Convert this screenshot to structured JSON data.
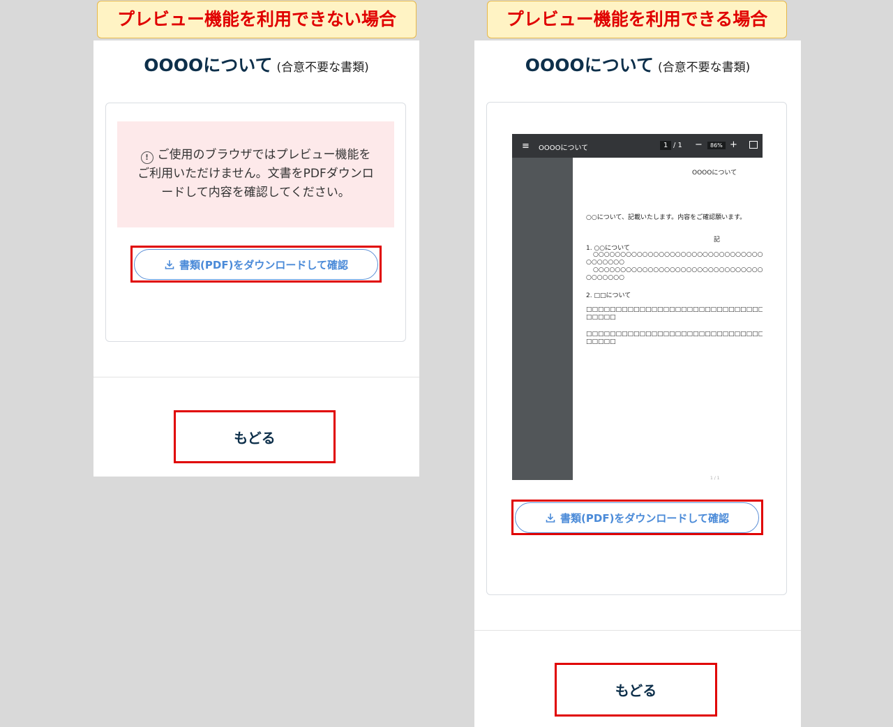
{
  "left": {
    "label": "プレビュー機能を利用できない場合",
    "title": "OOOOについて",
    "subtitle": "(合意不要な書類)",
    "alert_icon": "exclamation-circle-icon",
    "alert_text_1": "ご使用のブラウザではプレビュー機能を",
    "alert_text_2": "ご利用いただけません。文書をPDFダウンロ",
    "alert_text_3": "ードして内容を確認してください。",
    "download_label": "書類(PDF)をダウンロードして確認",
    "back_label": "もどる"
  },
  "right": {
    "label": "プレビュー機能を利用できる場合",
    "title": "OOOOについて",
    "subtitle": "(合意不要な書類)",
    "download_label": "書類(PDF)をダウンロードして確認",
    "back_label": "もどる",
    "viewer": {
      "doc_name": "OOOOについて",
      "page_current": "1",
      "page_total": "/ 1",
      "zoom": "86%",
      "page_title": "OOOOについて",
      "intro": "○○について、記載いたします。内容をご確認願います。",
      "ki": "記",
      "item1_heading": "1. ○○について",
      "item1_line1": "○○○○○○○○○○○○○○○○○○○○○○○○○○○○○○○○",
      "item1_line2": "○○○○○○○",
      "item1_line3": "○○○○○○○○○○○○○○○○○○○○○○○○○○○○○○○○",
      "item1_line4": "○○○○○○○",
      "item2_heading": "2. □□について",
      "item2_line1": "□□□□□□□□□□□□□□□□□□□□□□□□□□□□□□□□□□",
      "item2_line2": "□□□□□",
      "item2_line3": "□□□□□□□□□□□□□□□□□□□□□□□□□□□□□□□□□□",
      "item2_line4": "□□□□□",
      "footer_page": "1 / 1"
    }
  },
  "colors": {
    "highlight": "#e00000",
    "label_bg": "#fff3c4",
    "title": "#0d2f4a",
    "button": "#4a8ad8",
    "alert_bg": "#fde9ea"
  }
}
